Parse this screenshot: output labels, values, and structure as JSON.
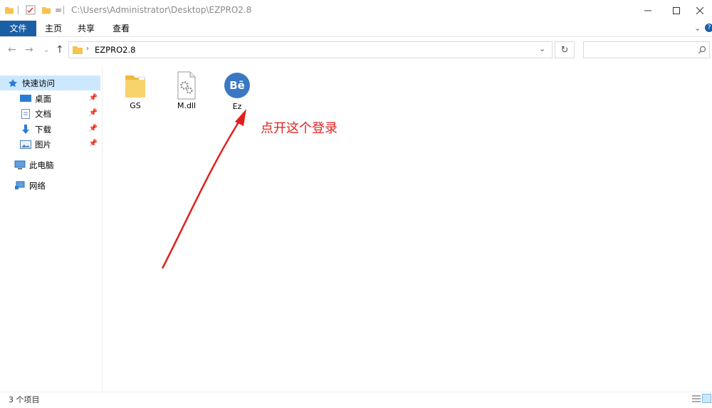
{
  "window": {
    "path": "C:\\Users\\Administrator\\Desktop\\EZPRO2.8",
    "minimize_icon": "minimize-icon",
    "maximize_icon": "maximize-icon",
    "close_icon": "close-icon"
  },
  "ribbon": {
    "tabs": [
      {
        "label": "文件"
      },
      {
        "label": "主页"
      },
      {
        "label": "共享"
      },
      {
        "label": "查看"
      }
    ]
  },
  "address": {
    "folder": "EZPRO2.8",
    "search_placeholder": ""
  },
  "sidebar": {
    "items": [
      {
        "label": "快速访问",
        "icon": "star-icon"
      },
      {
        "label": "桌面",
        "icon": "desktop-icon"
      },
      {
        "label": "文档",
        "icon": "document-icon"
      },
      {
        "label": "下载",
        "icon": "download-icon"
      },
      {
        "label": "图片",
        "icon": "picture-icon"
      },
      {
        "label": "此电脑",
        "icon": "computer-icon"
      },
      {
        "label": "网络",
        "icon": "network-icon"
      }
    ]
  },
  "files": [
    {
      "name": "GS",
      "icon": "folder-icon"
    },
    {
      "name": "M.dll",
      "icon": "dll-file-icon"
    },
    {
      "name": "Ez",
      "icon": "app-icon",
      "badge": "Bē"
    }
  ],
  "annotation": {
    "text": "点开这个登录",
    "color": "#e02020"
  },
  "status": {
    "count_text": "3 个项目"
  },
  "colors": {
    "file_tab": "#1a5fa6",
    "selected": "#cce8ff",
    "app_icon": "#3a78c3"
  }
}
